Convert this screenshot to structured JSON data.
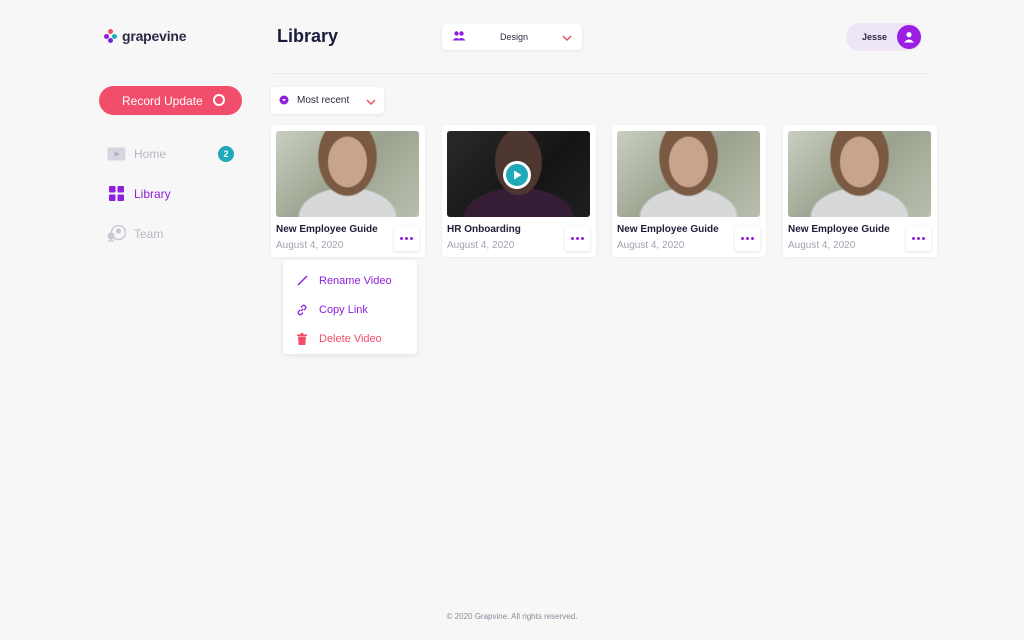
{
  "app": {
    "name": "grapevine"
  },
  "header": {
    "title": "Library",
    "team_select": {
      "value": "Design",
      "icon": "users-icon"
    },
    "user": {
      "name": "Jesse",
      "icon": "user-icon"
    }
  },
  "sidebar": {
    "record_button": "Record Update",
    "items": [
      {
        "label": "Home",
        "icon": "play-icon",
        "badge": "2",
        "active": false
      },
      {
        "label": "Library",
        "icon": "grid-icon",
        "active": true
      },
      {
        "label": "Team",
        "icon": "team-icon",
        "active": false
      }
    ]
  },
  "toolbar": {
    "sort": {
      "value": "Most recent"
    }
  },
  "videos": [
    {
      "title": "New Employee Guide",
      "date": "August 4, 2020"
    },
    {
      "title": "HR Onboarding",
      "date": "August 4, 2020",
      "hovered": true
    },
    {
      "title": "New Employee Guide",
      "date": "August 4, 2020"
    },
    {
      "title": "New Employee Guide",
      "date": "August 4, 2020"
    }
  ],
  "context_menu": {
    "items": [
      {
        "label": "Rename Video",
        "icon": "pencil-icon"
      },
      {
        "label": "Copy Link",
        "icon": "link-icon"
      },
      {
        "label": "Delete Video",
        "icon": "trash-icon"
      }
    ]
  },
  "footer": {
    "text": "© 2020 Grapvine. All rights reserved."
  },
  "colors": {
    "accent": "#8f1fdc",
    "record": "#f04e6b",
    "teal": "#1fa9b9",
    "background": "#f7f7f8"
  }
}
